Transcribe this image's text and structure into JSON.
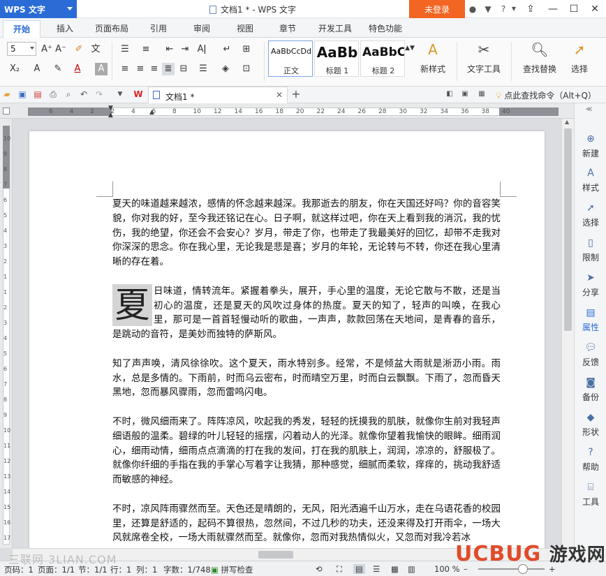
{
  "app": {
    "logo": "WPS 文字",
    "title": "文档1 * - WPS 文字",
    "login": "未登录"
  },
  "tabs": [
    "开始",
    "插入",
    "页面布局",
    "引用",
    "审阅",
    "视图",
    "章节",
    "开发工具",
    "特色功能"
  ],
  "ribbon": {
    "font_size": "5",
    "styles": [
      {
        "sample": "AaBbCcDd",
        "label": "正文"
      },
      {
        "sample": "AaBb",
        "label": "标题 1"
      },
      {
        "sample": "AaBbC",
        "label": "标题 2"
      }
    ],
    "new_style": "新样式",
    "text_tools": "文字工具",
    "find_replace": "查找替换",
    "select": "选择"
  },
  "quickbar": {
    "doc_tab": "文档1 *",
    "find_command": "点此查找命令（Alt+Q）"
  },
  "ruler": {
    "h_numbers": [
      "6",
      "4",
      "2",
      "2",
      "4",
      "6",
      "8",
      "10",
      "12",
      "14",
      "16",
      "18",
      "20",
      "22",
      "24",
      "26",
      "28",
      "30",
      "32",
      "34",
      "36",
      "38",
      "40"
    ],
    "v_numbers": [
      "10",
      "9",
      "8",
      "7",
      "6",
      "5",
      "4",
      "3",
      "2",
      "1",
      "1",
      "2",
      "3",
      "4",
      "5",
      "6",
      "7",
      "8",
      "9",
      "10",
      "11",
      "12",
      "13",
      "14",
      "15",
      "16",
      "17"
    ]
  },
  "document": {
    "p1": "夏天的味道越来越浓，感情的怀念越来越深。我那逝去的朋友，你在天国还好吗？你的音容笑貌，你对我的好，至今我还铭记在心。日子啊，就这样过吧，你在天上看到我的消沉，我的忧伤，我的绝望，你还会不会安心？岁月，带走了你，也带走了我最美好的回忆，却带不走我对你深深的思念。你在我心里，无论我是悲是喜；岁月的年轮，无论转与不转，你还在我心里清晰的存在着。",
    "dropcap": "夏",
    "p2": "日味道，情转流年。紧握着拳头，展开，手心里的温度，无论它散与不散，还是当初心的温度，还是夏天的风吹过身体的热度。夏天的知了，轻声的叫唤，在我心里，那可是一首首轻慢动听的歌曲，一声声，款款回荡在天地间，是青春的音乐，是跳动的音符，是美妙而独特的萨斯风。",
    "p3": "知了声声唤，清风徐徐吹。这个夏天，雨水特别多。经常，不是倾盆大雨就是淅沥小雨。雨水，总是多情的。下雨前，时而乌云密布，时而晴空万里，时而白云飘飘。下雨了，忽而昏天黑地，忽而暴风骤雨，忽而雷鸣闪电。",
    "p4": "不时，微风细雨来了。阵阵凉风，吹起我的秀发，轻轻的抚摸我的肌肤，就像你生前对我轻声细语般的温柔。碧绿的叶儿轻轻的摇摆，闪着动人的光泽。就像你望着我愉快的眼眸。细雨润心，细雨动情，细雨点点滴滴的打在我的发间，打在我的肌肤上，润润，凉凉的，舒服极了。就像你纤细的手指在我的手掌心写着字让我猜，那种感觉，细腻而柔软，痒痒的，挑动我舒适而敏感的神经。",
    "p5": "不时，凉风阵雨骤然而至。天色还是晴朗的，无风，阳光洒遍千山万水，走在乌语花香的校园里，还算是舒适的，起码不算很热，忽然间，不过几秒的功夫，还没来得及打开雨伞，一场大风就席卷全校，一场大雨就骤然而至。就像你，忽而对我热情似火，又忽而对我冷若冰"
  },
  "rpanel": [
    "新建",
    "样式",
    "选择",
    "限制",
    "分享",
    "属性",
    "反馈",
    "备份",
    "形状",
    "帮助",
    "工具"
  ],
  "status": {
    "page_code": "页码：1",
    "pages": "页面：1/1",
    "section": "节：1/1",
    "row": "行：1",
    "col": "列：1",
    "words": "字数：1/748",
    "spell": "拼写检查",
    "zoom": "100 %"
  },
  "watermarks": {
    "left": "三联网 3LIAN.COM",
    "brand": "UCBUG",
    "brand_cn": "游戏网"
  }
}
